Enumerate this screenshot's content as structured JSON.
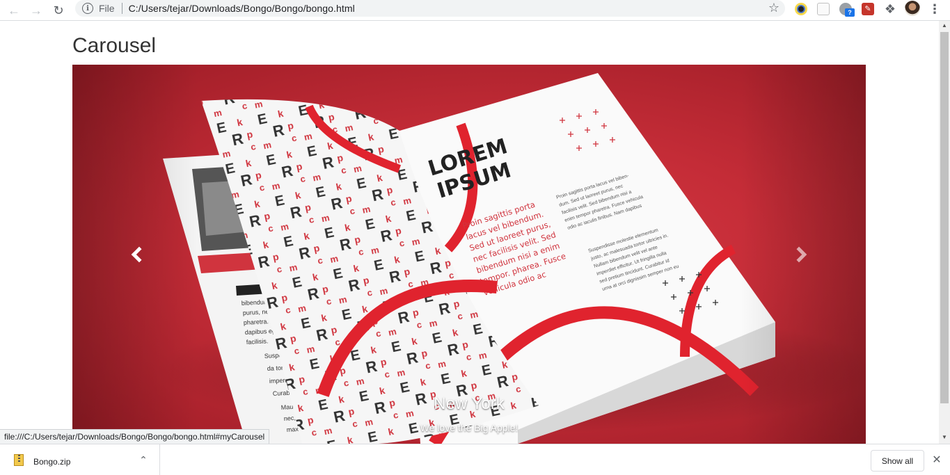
{
  "browser": {
    "file_label": "File",
    "url": "C:/Users/tejar/Downloads/Bongo/Bongo/bongo.html",
    "icons": [
      "back-arrow-icon",
      "forward-arrow-icon",
      "reload-icon",
      "info-icon",
      "star-icon",
      "extension-icons",
      "puzzle-icon",
      "profile-avatar",
      "kebab-menu-icon"
    ]
  },
  "page": {
    "title": "Carousel"
  },
  "carousel": {
    "slide_image_text": {
      "heading_line1": "LOREM",
      "heading_line2": "IPSUM",
      "pullquote": [
        "Proin sagittis porta",
        "lacus vel bibendum.",
        "Sed ut laoreet purus,",
        "nec facilisis velit. Sed",
        "bibendum nisi a enim",
        "tempor. pharea. Fusce",
        "vehicula odio ac"
      ]
    },
    "caption_title": "New York",
    "caption_text": "We love the Big Apple!",
    "prev_icon": "chevron-left-icon",
    "next_icon": "chevron-right-icon",
    "brand_color": "#d0343e"
  },
  "status_bar": {
    "link_url": "file:///C:/Users/tejar/Downloads/Bongo/Bongo/bongo.html#myCarousel"
  },
  "downloads": {
    "file_name": "Bongo.zip",
    "show_all_label": "Show all"
  }
}
